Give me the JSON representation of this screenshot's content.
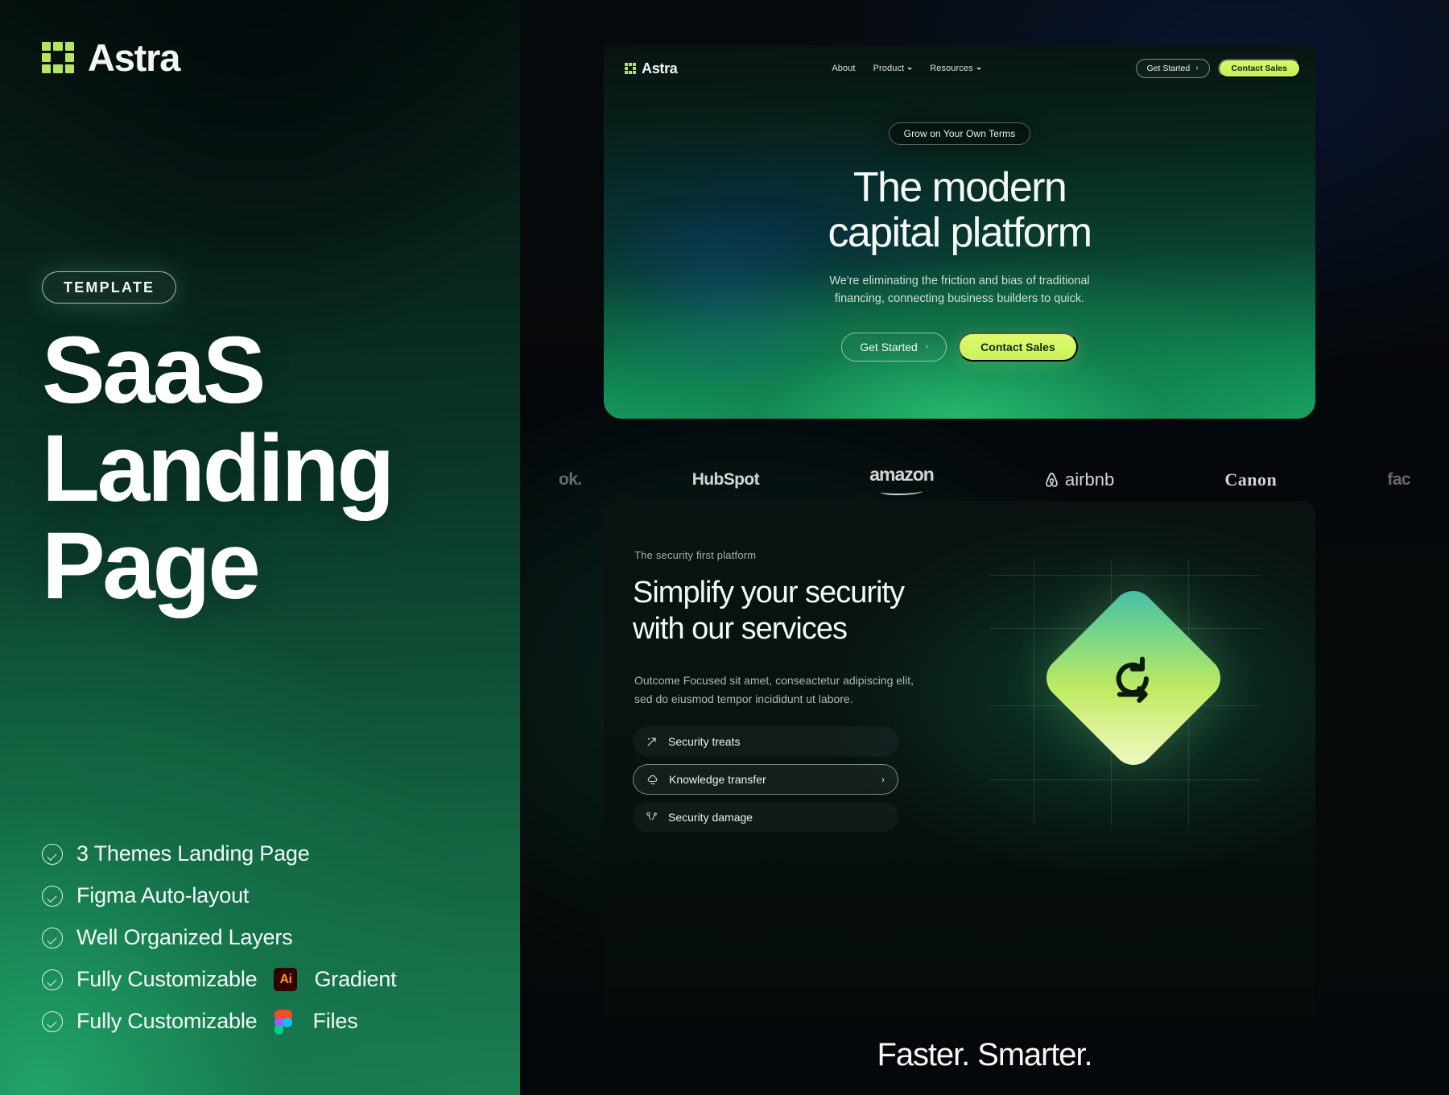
{
  "promo": {
    "brand_name": "Astra",
    "brand_icon": "astra-grid-logo",
    "badge": "TEMPLATE",
    "title_line1": "SaaS",
    "title_line2": "Landing",
    "title_line3": "Page",
    "features": [
      {
        "icon": "check-circle-icon",
        "text": "3 Themes Landing Page"
      },
      {
        "icon": "check-circle-icon",
        "text": "Figma Auto-layout"
      },
      {
        "icon": "check-circle-icon",
        "text": "Well Organized Layers"
      },
      {
        "icon": "check-circle-icon",
        "text_before": "Fully Customizable",
        "chip": "Ai",
        "text_after": "Gradient"
      },
      {
        "icon": "check-circle-icon",
        "text_before": "Fully Customizable",
        "chip": "figma-logo-icon",
        "text_after": "Files"
      }
    ]
  },
  "site": {
    "nav": {
      "brand_name": "Astra",
      "brand_icon": "astra-grid-logo",
      "links": [
        {
          "label": "About",
          "has_dropdown": false
        },
        {
          "label": "Product",
          "has_dropdown": true
        },
        {
          "label": "Resources",
          "has_dropdown": true
        }
      ],
      "cta_ghost": "Get Started",
      "cta_primary": "Contact Sales"
    },
    "hero": {
      "pill": "Grow on Your Own Terms",
      "heading_line1": "The modern",
      "heading_line2": "capital platform",
      "sub_line1": "We're eliminating the friction and bias of traditional",
      "sub_line2": "financing, connecting business builders to quick.",
      "cta_ghost": "Get Started",
      "cta_primary": "Contact Sales"
    },
    "logos": [
      {
        "name": "facebook-logo-partial",
        "text": "ok."
      },
      {
        "name": "hubspot-logo",
        "text": "HubSpot"
      },
      {
        "name": "amazon-logo",
        "text": "amazon"
      },
      {
        "name": "airbnb-logo",
        "text": "airbnb"
      },
      {
        "name": "canon-logo",
        "text": "Canon"
      },
      {
        "name": "facebook-logo-partial-right",
        "text": "fac"
      }
    ],
    "security": {
      "eyebrow": "The security first platform",
      "heading_line1": "Simplify your security",
      "heading_line2": "with our services",
      "body_line1": "Outcome Focused sit amet, conseactetur adipiscing elit,",
      "body_line2": "sed do eiusmod tempor incididunt ut labore.",
      "items": [
        {
          "label": "Security treats",
          "icon": "sparkle-arrow-icon",
          "active": false,
          "chevron": ""
        },
        {
          "label": "Knowledge transfer",
          "icon": "cloud-refresh-icon",
          "active": true,
          "chevron": "›"
        },
        {
          "label": "Security damage",
          "icon": "network-nodes-icon",
          "active": false,
          "chevron": ""
        }
      ],
      "graphic_icon": "refresh-cycle-icon"
    },
    "tagline": "Faster. Smarter."
  },
  "colors": {
    "lime": "#cdf35c",
    "green": "#1aa863",
    "dark": "#05080a",
    "panel_green": "#1a7d52"
  }
}
